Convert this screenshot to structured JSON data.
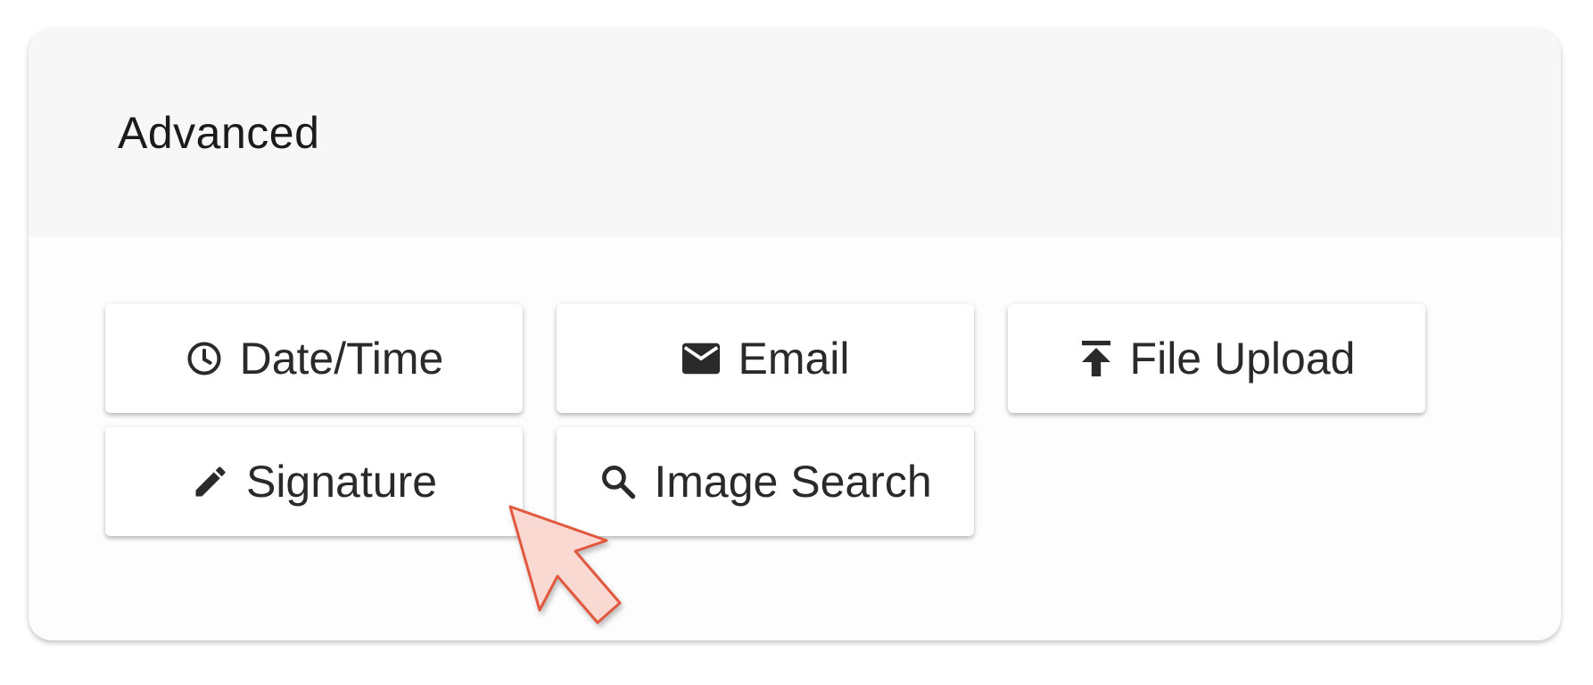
{
  "section": {
    "title": "Advanced"
  },
  "buttons": [
    {
      "label": "Date/Time",
      "icon": "clock-icon"
    },
    {
      "label": "Email",
      "icon": "mail-icon"
    },
    {
      "label": "File Upload",
      "icon": "upload-icon"
    },
    {
      "label": "Signature",
      "icon": "pencil-icon"
    },
    {
      "label": "Image Search",
      "icon": "search-icon"
    }
  ],
  "colors": {
    "header_bg": "#f7f7f7",
    "panel_bg": "#fdfdfd",
    "text": "#2a2a2a",
    "cursor_fill": "#fbd9d3",
    "cursor_stroke": "#e2583e"
  }
}
